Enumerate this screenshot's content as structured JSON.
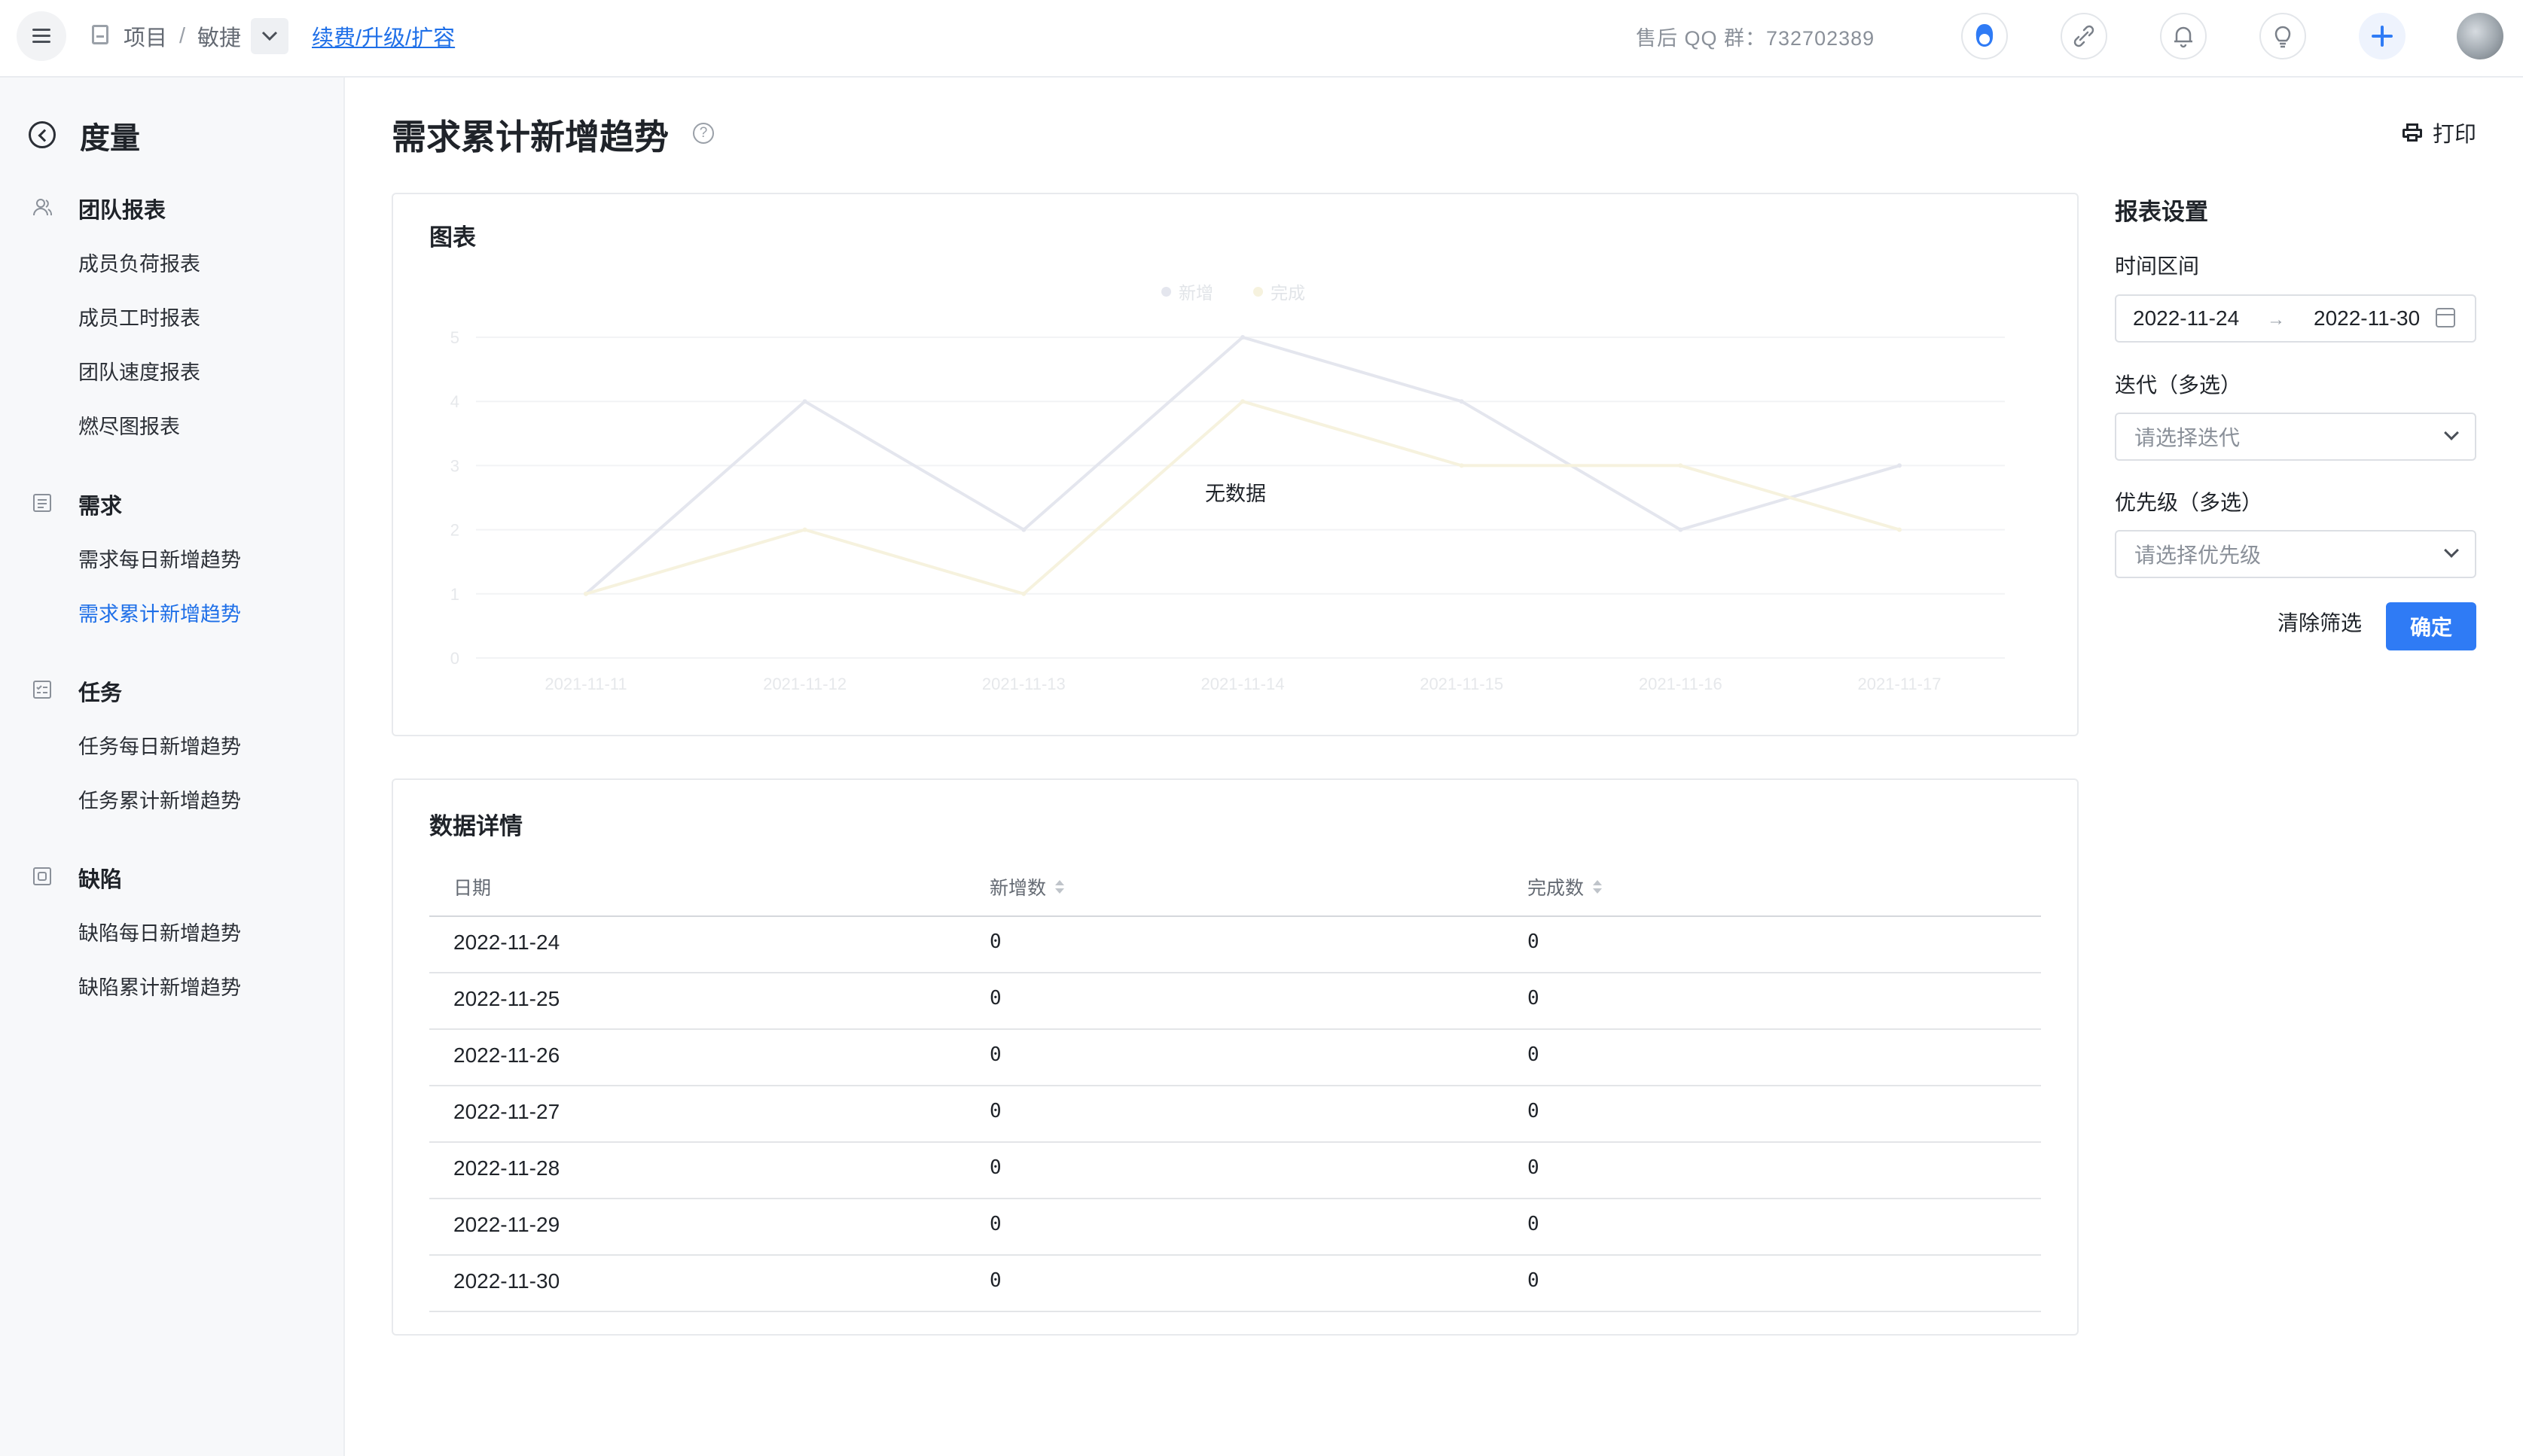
{
  "topbar": {
    "breadcrumb_project": "项目",
    "breadcrumb_sep": "/",
    "breadcrumb_team": "敏捷",
    "renew_link": "续费/升级/扩容",
    "qq_group": "售后 QQ 群：732702389"
  },
  "sidebar": {
    "title": "度量",
    "groups": [
      {
        "label": "团队报表",
        "items": [
          "成员负荷报表",
          "成员工时报表",
          "团队速度报表",
          "燃尽图报表"
        ]
      },
      {
        "label": "需求",
        "items": [
          "需求每日新增趋势",
          "需求累计新增趋势"
        ]
      },
      {
        "label": "任务",
        "items": [
          "任务每日新增趋势",
          "任务累计新增趋势"
        ]
      },
      {
        "label": "缺陷",
        "items": [
          "缺陷每日新增趋势",
          "缺陷累计新增趋势"
        ]
      }
    ],
    "active_item": "需求累计新增趋势"
  },
  "page": {
    "title": "需求累计新增趋势",
    "print_label": "打印"
  },
  "chart_card": {
    "title": "图表",
    "no_data": "无数据"
  },
  "chart_data": {
    "type": "line",
    "categories": [
      "2021-11-11",
      "2021-11-12",
      "2021-11-13",
      "2021-11-14",
      "2021-11-15",
      "2021-11-16",
      "2021-11-17"
    ],
    "series": [
      {
        "name": "新增",
        "values": [
          1,
          4,
          2,
          5,
          4,
          2,
          3
        ],
        "color": "#e4e6ee"
      },
      {
        "name": "完成",
        "values": [
          1,
          2,
          1,
          4,
          3,
          3,
          2
        ],
        "color": "#f6f2de"
      }
    ],
    "yticks": [
      0,
      1,
      2,
      3,
      4,
      5
    ],
    "ylim": [
      0,
      5
    ],
    "grid": true,
    "legend": "top-center"
  },
  "table_card": {
    "title": "数据详情",
    "columns": [
      "日期",
      "新增数",
      "完成数"
    ],
    "rows": [
      [
        "2022-11-24",
        "0",
        "0"
      ],
      [
        "2022-11-25",
        "0",
        "0"
      ],
      [
        "2022-11-26",
        "0",
        "0"
      ],
      [
        "2022-11-27",
        "0",
        "0"
      ],
      [
        "2022-11-28",
        "0",
        "0"
      ],
      [
        "2022-11-29",
        "0",
        "0"
      ],
      [
        "2022-11-30",
        "0",
        "0"
      ]
    ]
  },
  "settings": {
    "title": "报表设置",
    "time_label": "时间区间",
    "date_start": "2022-11-24",
    "date_end": "2022-11-30",
    "iteration_label": "迭代（多选）",
    "iteration_placeholder": "请选择迭代",
    "priority_label": "优先级（多选）",
    "priority_placeholder": "请选择优先级",
    "clear_label": "清除筛选",
    "confirm_label": "确定"
  },
  "colors": {
    "accent": "#2f7bf5",
    "link": "#1e6fe8"
  }
}
